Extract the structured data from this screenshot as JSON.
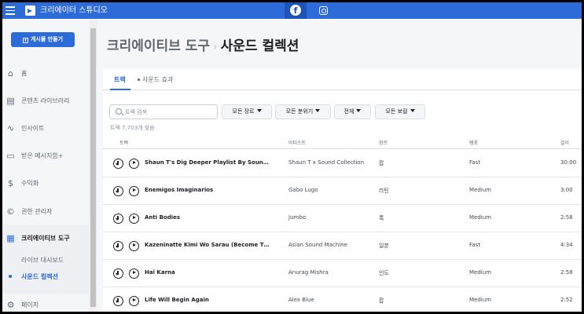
{
  "app": {
    "title": "크리에이터 스튜디오"
  },
  "sidebar": {
    "create_button": "게시물 만들기",
    "items": [
      {
        "label": "홈",
        "icon": "home-icon"
      },
      {
        "label": "콘텐츠 라이브러리",
        "icon": "library-icon"
      },
      {
        "label": "인사이트",
        "icon": "insights-icon"
      },
      {
        "label": "받은 메시지함+",
        "icon": "inbox-icon"
      },
      {
        "label": "수익화",
        "icon": "monetization-icon"
      },
      {
        "label": "권한 관리자",
        "icon": "rights-icon"
      },
      {
        "label": "크리에이티브 도구",
        "icon": "creative-tools-icon"
      },
      {
        "label": "페이지",
        "icon": "pages-icon"
      }
    ],
    "sub_items": [
      {
        "label": "라이브 대시보드"
      },
      {
        "label": "사운드 컬렉션"
      }
    ]
  },
  "header": {
    "breadcrumb_parent": "크리에이티브 도구",
    "separator": "›",
    "breadcrumb_current": "사운드 컬렉션"
  },
  "tabs": [
    {
      "label": "트랙"
    },
    {
      "label": "사운드 효과"
    }
  ],
  "search": {
    "placeholder": "트랙 검색",
    "value": ""
  },
  "filters": [
    {
      "label": "모든 장르"
    },
    {
      "label": "모든 분위기"
    },
    {
      "label": "전체"
    },
    {
      "label": "모든 보컬"
    }
  ],
  "results_count": "트랙 7,703개 찾음",
  "columns": [
    "트랙",
    "아티스트",
    "장르",
    "템포",
    "길이"
  ],
  "tracks": [
    {
      "title": "Shaun T's Dig Deeper Playlist By Sound...",
      "artist": "Shaun T x Sound Collection",
      "genre": "팝",
      "tempo": "Fast",
      "duration": "30:00"
    },
    {
      "title": "Enemigos Imaginarios",
      "artist": "Gabo Lugo",
      "genre": "라틴",
      "tempo": "Medium",
      "duration": "3:00"
    },
    {
      "title": "Anti Bodies",
      "artist": "Jumbo",
      "genre": "록",
      "tempo": "Medium",
      "duration": "2:58"
    },
    {
      "title": "Kazeninatte Kimi Wo Sarau (Become The...",
      "artist": "Asian Sound Machine",
      "genre": "일본",
      "tempo": "Fast",
      "duration": "4:34"
    },
    {
      "title": "Hai Karna",
      "artist": "Anurag Mishra",
      "genre": "인도",
      "tempo": "Medium",
      "duration": "2:58"
    },
    {
      "title": "Life Will Begin Again",
      "artist": "Alex Blue",
      "genre": "팝",
      "tempo": "Medium",
      "duration": "2:52"
    }
  ],
  "colors": {
    "accent": "#2d6bd9",
    "background": "#f5f6f7"
  }
}
